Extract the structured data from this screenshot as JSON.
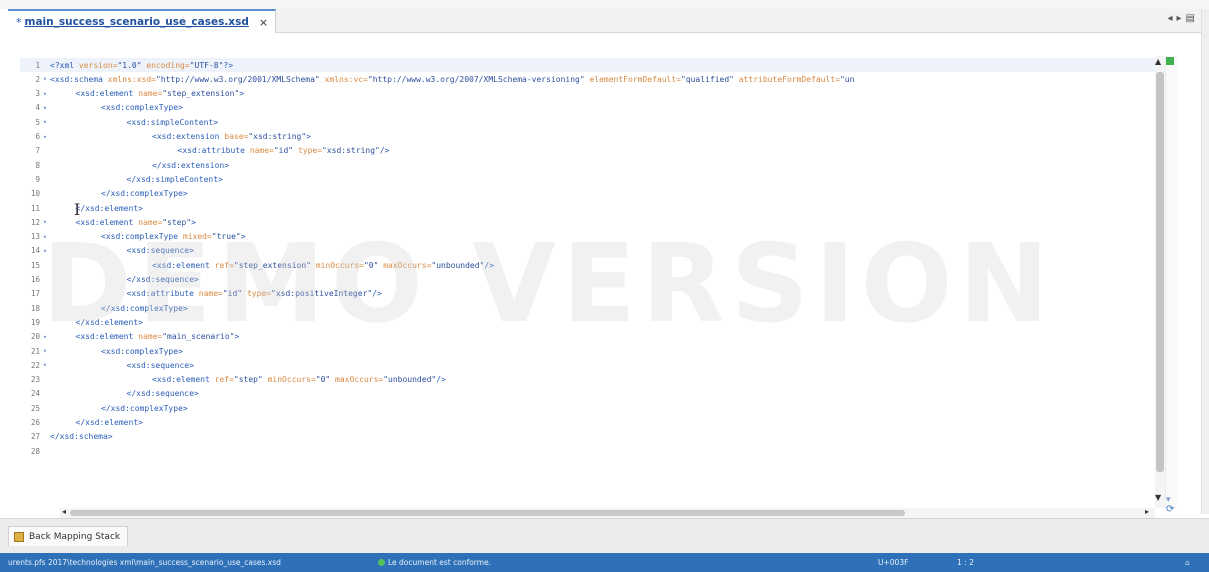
{
  "editor_tab": {
    "dirty_marker": "*",
    "filename": "main_success_scenario_use_cases.xsd",
    "close": "×"
  },
  "tab_nav": {
    "left": "◂",
    "right": "▸",
    "menu": "▤"
  },
  "code_lines": [
    {
      "n": "1",
      "fold": "",
      "indent": 0,
      "parts": [
        {
          "t": "<?xml ",
          "c": "kw"
        },
        {
          "t": "version=",
          "c": "attr"
        },
        {
          "t": "\"1.0\" ",
          "c": "val"
        },
        {
          "t": "encoding=",
          "c": "attr"
        },
        {
          "t": "\"UTF-8\"",
          "c": "val"
        },
        {
          "t": "?>",
          "c": "kw"
        }
      ]
    },
    {
      "n": "2",
      "fold": "▾",
      "indent": 0,
      "parts": [
        {
          "t": "<xsd:schema ",
          "c": "kw"
        },
        {
          "t": "xmlns:xsd=",
          "c": "attr"
        },
        {
          "t": "\"http://www.w3.org/2001/XMLSchema\" ",
          "c": "val"
        },
        {
          "t": "xmlns:vc=",
          "c": "attr"
        },
        {
          "t": "\"http://www.w3.org/2007/XMLSchema-versioning\" ",
          "c": "val"
        },
        {
          "t": "elementFormDefault=",
          "c": "attr"
        },
        {
          "t": "\"qualified\" ",
          "c": "val"
        },
        {
          "t": "attributeFormDefault=",
          "c": "attr"
        },
        {
          "t": "\"un",
          "c": "val"
        }
      ]
    },
    {
      "n": "3",
      "fold": "▾",
      "indent": 1,
      "parts": [
        {
          "t": "<xsd:element ",
          "c": "kw"
        },
        {
          "t": "name=",
          "c": "attr"
        },
        {
          "t": "\"step_extension\"",
          "c": "val"
        },
        {
          "t": ">",
          "c": "kw"
        }
      ]
    },
    {
      "n": "4",
      "fold": "▾",
      "indent": 2,
      "parts": [
        {
          "t": "<xsd:complexType>",
          "c": "kw"
        }
      ]
    },
    {
      "n": "5",
      "fold": "▾",
      "indent": 3,
      "parts": [
        {
          "t": "<xsd:simpleContent>",
          "c": "kw"
        }
      ]
    },
    {
      "n": "6",
      "fold": "▾",
      "indent": 4,
      "parts": [
        {
          "t": "<xsd:extension ",
          "c": "kw"
        },
        {
          "t": "base=",
          "c": "attr"
        },
        {
          "t": "\"xsd:string\"",
          "c": "val"
        },
        {
          "t": ">",
          "c": "kw"
        }
      ]
    },
    {
      "n": "7",
      "fold": "",
      "indent": 5,
      "parts": [
        {
          "t": "<xsd:attribute ",
          "c": "kw"
        },
        {
          "t": "name=",
          "c": "attr"
        },
        {
          "t": "\"id\" ",
          "c": "val"
        },
        {
          "t": "type=",
          "c": "attr"
        },
        {
          "t": "\"xsd:string\"",
          "c": "val"
        },
        {
          "t": "/>",
          "c": "kw"
        }
      ]
    },
    {
      "n": "8",
      "fold": "",
      "indent": 4,
      "parts": [
        {
          "t": "</xsd:extension>",
          "c": "kw"
        }
      ]
    },
    {
      "n": "9",
      "fold": "",
      "indent": 3,
      "parts": [
        {
          "t": "</xsd:simpleContent>",
          "c": "kw"
        }
      ]
    },
    {
      "n": "10",
      "fold": "",
      "indent": 2,
      "parts": [
        {
          "t": "</xsd:complexType>",
          "c": "kw"
        }
      ]
    },
    {
      "n": "11",
      "fold": "",
      "indent": 1,
      "parts": [
        {
          "t": "</xsd:element>",
          "c": "kw"
        }
      ]
    },
    {
      "n": "12",
      "fold": "▾",
      "indent": 1,
      "parts": [
        {
          "t": "<xsd:element ",
          "c": "kw"
        },
        {
          "t": "name=",
          "c": "attr"
        },
        {
          "t": "\"step\"",
          "c": "val"
        },
        {
          "t": ">",
          "c": "kw"
        }
      ]
    },
    {
      "n": "13",
      "fold": "▾",
      "indent": 2,
      "parts": [
        {
          "t": "<xsd:complexType ",
          "c": "kw"
        },
        {
          "t": "mixed=",
          "c": "attr"
        },
        {
          "t": "\"true\"",
          "c": "val"
        },
        {
          "t": ">",
          "c": "kw"
        }
      ]
    },
    {
      "n": "14",
      "fold": "▾",
      "indent": 3,
      "parts": [
        {
          "t": "<xsd:sequence>",
          "c": "kw"
        }
      ]
    },
    {
      "n": "15",
      "fold": "",
      "indent": 4,
      "parts": [
        {
          "t": "<xsd:element ",
          "c": "kw"
        },
        {
          "t": "ref=",
          "c": "attr"
        },
        {
          "t": "\"step_extension\" ",
          "c": "val"
        },
        {
          "t": "minOccurs=",
          "c": "attr"
        },
        {
          "t": "\"0\" ",
          "c": "val"
        },
        {
          "t": "maxOccurs=",
          "c": "attr"
        },
        {
          "t": "\"unbounded\"",
          "c": "val"
        },
        {
          "t": "/>",
          "c": "kw"
        }
      ]
    },
    {
      "n": "16",
      "fold": "",
      "indent": 3,
      "parts": [
        {
          "t": "</xsd:sequence>",
          "c": "kw"
        }
      ]
    },
    {
      "n": "17",
      "fold": "",
      "indent": 3,
      "parts": [
        {
          "t": "<xsd:attribute ",
          "c": "kw"
        },
        {
          "t": "name=",
          "c": "attr"
        },
        {
          "t": "\"id\" ",
          "c": "val"
        },
        {
          "t": "type=",
          "c": "attr"
        },
        {
          "t": "\"xsd:positiveInteger\"",
          "c": "val"
        },
        {
          "t": "/>",
          "c": "kw"
        }
      ]
    },
    {
      "n": "18",
      "fold": "",
      "indent": 2,
      "parts": [
        {
          "t": "</xsd:complexType>",
          "c": "kw"
        }
      ]
    },
    {
      "n": "19",
      "fold": "",
      "indent": 1,
      "parts": [
        {
          "t": "</xsd:element>",
          "c": "kw"
        }
      ]
    },
    {
      "n": "20",
      "fold": "▾",
      "indent": 1,
      "parts": [
        {
          "t": "<xsd:element ",
          "c": "kw"
        },
        {
          "t": "name=",
          "c": "attr"
        },
        {
          "t": "\"main_scenario\"",
          "c": "val"
        },
        {
          "t": ">",
          "c": "kw"
        }
      ]
    },
    {
      "n": "21",
      "fold": "▾",
      "indent": 2,
      "parts": [
        {
          "t": "<xsd:complexType>",
          "c": "kw"
        }
      ]
    },
    {
      "n": "22",
      "fold": "▾",
      "indent": 3,
      "parts": [
        {
          "t": "<xsd:sequence>",
          "c": "kw"
        }
      ]
    },
    {
      "n": "23",
      "fold": "",
      "indent": 4,
      "parts": [
        {
          "t": "<xsd:element ",
          "c": "kw"
        },
        {
          "t": "ref=",
          "c": "attr"
        },
        {
          "t": "\"step\" ",
          "c": "val"
        },
        {
          "t": "minOccurs=",
          "c": "attr"
        },
        {
          "t": "\"0\" ",
          "c": "val"
        },
        {
          "t": "maxOccurs=",
          "c": "attr"
        },
        {
          "t": "\"unbounded\"",
          "c": "val"
        },
        {
          "t": "/>",
          "c": "kw"
        }
      ]
    },
    {
      "n": "24",
      "fold": "",
      "indent": 3,
      "parts": [
        {
          "t": "</xsd:sequence>",
          "c": "kw"
        }
      ]
    },
    {
      "n": "25",
      "fold": "",
      "indent": 2,
      "parts": [
        {
          "t": "</xsd:complexType>",
          "c": "kw"
        }
      ]
    },
    {
      "n": "26",
      "fold": "",
      "indent": 1,
      "parts": [
        {
          "t": "</xsd:element>",
          "c": "kw"
        }
      ]
    },
    {
      "n": "27",
      "fold": "",
      "indent": 0,
      "parts": [
        {
          "t": "</xsd:schema>",
          "c": "kw"
        }
      ]
    },
    {
      "n": "28",
      "fold": "",
      "indent": 0,
      "parts": []
    }
  ],
  "watermark": "DEMO VERSION",
  "caret_glyph": "I",
  "scroll": {
    "up": "▲",
    "down": "▼",
    "left": "◂",
    "right": "▸"
  },
  "bottom_panel": {
    "tab_label": "Back Mapping Stack"
  },
  "status_bar": {
    "path": "urents.pfs 2017\\technologies xml\\main_success_scenario_use_cases.xsd",
    "validation": "Le document est conforme.",
    "encoding": "U+003F",
    "position": "1 : 2",
    "right": "⌂"
  },
  "colors": {
    "tab_accent": "#5b8fd8",
    "status_bar": "#2f71b8",
    "valid_ok": "#55c05a",
    "tag": "#2b5eb8",
    "attribute": "#d98a42",
    "value": "#2d4f9e"
  },
  "icons": {
    "tab_close": "close-icon",
    "stack": "stack-icon",
    "valid": "validation-ok-icon"
  }
}
